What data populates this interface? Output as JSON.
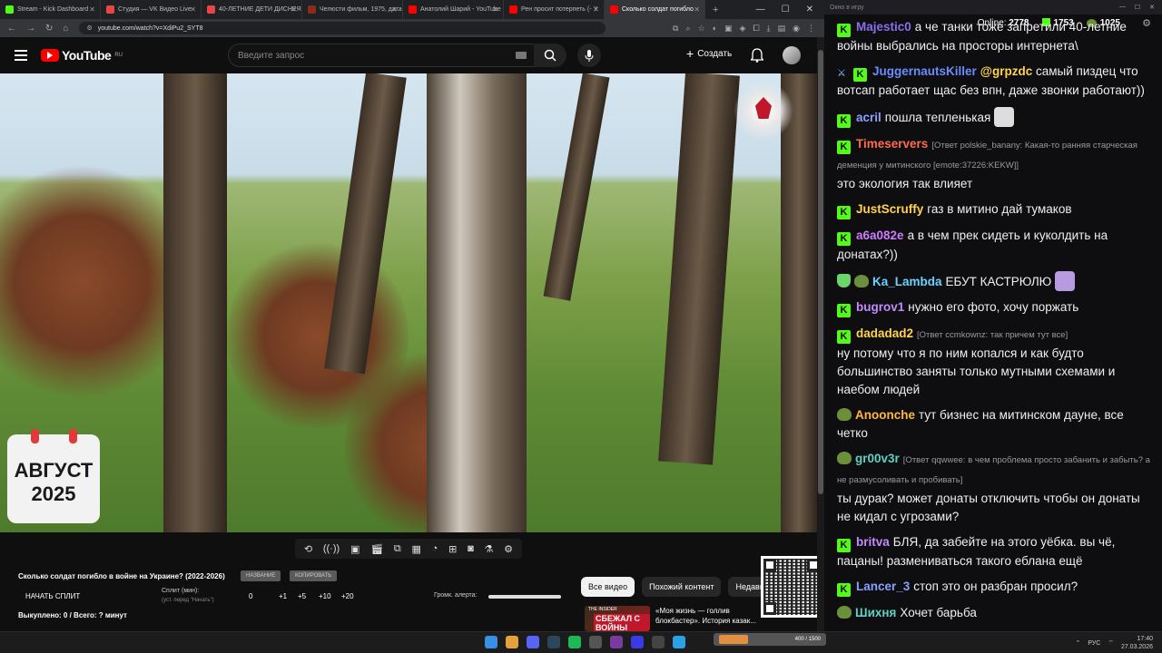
{
  "browser": {
    "tabs": [
      {
        "title": "Stream - Kick Dashboard",
        "color": "#53fc18",
        "active": false
      },
      {
        "title": "Студия — VK Видео Live",
        "color": "#e64646",
        "active": false
      },
      {
        "title": "40-ЛЕТНИЕ ДЕТИ ДИСНЕЯ",
        "color": "#e64646",
        "active": false
      },
      {
        "title": "Челюсти фильм, 1975, дата",
        "color": "#8b2b1a",
        "active": false
      },
      {
        "title": "Анатолий Шарий - YouTube",
        "color": "#ff0000",
        "active": false
      },
      {
        "title": "Рен просит потерпеть (- Y",
        "color": "#ff0000",
        "active": false
      },
      {
        "title": "Сколько солдат погибло",
        "color": "#ff0000",
        "active": true
      }
    ],
    "new_tab": "+",
    "url": "youtube.com/watch?v=XdiPu2_SYT8"
  },
  "youtube": {
    "logo_text": "YouTube",
    "logo_region": "RU",
    "search_placeholder": "Введите запрос",
    "create_label": "Создать"
  },
  "video": {
    "overlay_month": "АВГУСТ",
    "overlay_year": "2025"
  },
  "controls": {
    "icons": [
      "loop-icon",
      "broadcast-icon",
      "watch-later-icon",
      "clapper-icon",
      "pip-icon",
      "film-icon",
      "speed-icon",
      "add-icon",
      "screenshot-icon",
      "lab-icon",
      "settings-icon"
    ],
    "video_title": "Сколько солдат погибло в войне на Украине? (2022-2026)",
    "pill_1": "НАЗВАНИЕ",
    "pill_2": "КОПИРОВАТЬ",
    "start_split": "НАЧАТЬ СПЛИТ",
    "split_label": "Сплит (мин):",
    "split_sub": "(уст. перед \"Начать\")",
    "split_values": [
      "0",
      "+1",
      "+5",
      "+10",
      "+20"
    ],
    "alert_label": "Громк. алерта:",
    "alert_level": 1.0,
    "bought": "Выкуплено: 0 / Всего: ? минут"
  },
  "chips": [
    "Все видео",
    "Похожий контент",
    "Недавно"
  ],
  "recommendation": {
    "thumb_brand": "THE INSIDER",
    "thumb_text": "СБЕЖАЛ С ВОЙНЫ",
    "title_line1": "«Моя жизнь — голлив",
    "title_line2": "блокбастер». История казак..."
  },
  "chat": {
    "window_title": "Окно в игру",
    "online_label": "Online:",
    "online_count": "2778",
    "kick_count": "1753",
    "pepe_count": "1025",
    "messages": [
      {
        "user": "Majestic0",
        "color": "#8b6fe8",
        "badges": [
          "k"
        ],
        "reply": "",
        "mention": "",
        "text": "а че танки тоже запретили 40-летние войны выбрались на просторы интернета\\"
      },
      {
        "user": "JuggernautsKiller",
        "color": "#6b8cff",
        "badges": [
          "sword",
          "k"
        ],
        "reply": "",
        "mention": "@grpzdc",
        "text": "самый пиздец что вотсап работает щас без впн, даже звонки работают))"
      },
      {
        "user": "acril",
        "color": "#8aa0ff",
        "badges": [
          "k"
        ],
        "reply": "",
        "mention": "",
        "text": "пошла тепленькая",
        "emote": "#dddddd"
      },
      {
        "user": "Timeservers",
        "color": "#ff6b4a",
        "badges": [
          "k"
        ],
        "reply": "[Ответ polskie_banany: Какая-то ранняя старческая деменция у митинского [emote:37226:KEKW]]",
        "mention": "",
        "text": "это экология так влияет"
      },
      {
        "user": "JustScruffy",
        "color": "#ffd34d",
        "badges": [
          "k"
        ],
        "reply": "",
        "mention": "",
        "text": "газ в митино дай тумаков"
      },
      {
        "user": "a6a082e",
        "color": "#d07bff",
        "badges": [
          "k"
        ],
        "reply": "",
        "mention": "",
        "text": "а в чем прек сидеть и куколдить на донатах?))"
      },
      {
        "user": "Ka_Lambda",
        "color": "#6ad2ff",
        "badges": [
          "shield",
          "pepe"
        ],
        "reply": "",
        "mention": "",
        "text": "ЕБУТ КАСТРЮЛЮ",
        "emote": "#b79ae0"
      },
      {
        "user": "bugrov1",
        "color": "#c48aff",
        "badges": [
          "k"
        ],
        "reply": "",
        "mention": "",
        "text": "нужно его фото, хочу поржать"
      },
      {
        "user": "dadadad2",
        "color": "#ffd34d",
        "badges": [
          "k"
        ],
        "reply": "[Ответ ccmkownz: так причем тут все]",
        "mention": "",
        "text": "ну потому что я по ним копался и как будто большинство заняты только мутными схемами и наебом людей"
      },
      {
        "user": "Anoonche",
        "color": "#ffb83d",
        "badges": [
          "pepe"
        ],
        "reply": "",
        "mention": "",
        "text": "тут бизнес на митинском дауне, все четко"
      },
      {
        "user": "gr00v3r",
        "color": "#5fd0c2",
        "badges": [
          "pepe"
        ],
        "reply": "[Ответ qqwwee: в чем проблема просто забанить и забыть? а не размусоливать и пробивать]",
        "mention": "",
        "text": "ты дурак? может донаты отключить чтобы он донаты не кидал с угрозами?"
      },
      {
        "user": "britva",
        "color": "#c48aff",
        "badges": [
          "k"
        ],
        "reply": "",
        "mention": "",
        "text": "БЛЯ, да забейте на этого уёбка. вы чё, пацаны! размениваться такого еблана ещё"
      },
      {
        "user": "Lancer_3",
        "color": "#8aa0ff",
        "badges": [
          "k"
        ],
        "reply": "",
        "mention": "",
        "text": "стоп это он разбран просил?"
      },
      {
        "user": "Шихня",
        "color": "#5fd0c2",
        "badges": [
          "pepe"
        ],
        "reply": "",
        "mention": "",
        "text": "Хочет барьба"
      }
    ]
  },
  "kick_progress": {
    "label": "400 / 1500",
    "fraction": 0.27
  },
  "taskbar": {
    "lang": "РУС",
    "time": "17:40",
    "date": "27.03.2026"
  }
}
